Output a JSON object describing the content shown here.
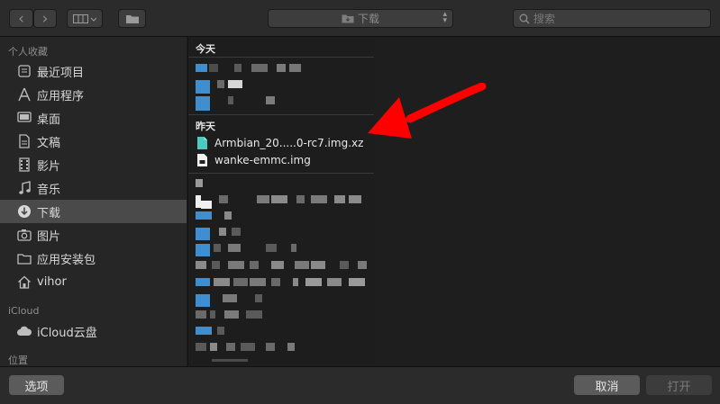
{
  "toolbar": {
    "back_glyph": "‹",
    "forward_glyph": "›",
    "location": "下载",
    "search_placeholder": "搜索"
  },
  "sidebar": {
    "favorites_header": "个人收藏",
    "items": [
      {
        "label": "最近项目",
        "icon": "recent-icon"
      },
      {
        "label": "应用程序",
        "icon": "applications-icon"
      },
      {
        "label": "桌面",
        "icon": "desktop-icon"
      },
      {
        "label": "文稿",
        "icon": "documents-icon"
      },
      {
        "label": "影片",
        "icon": "movies-icon"
      },
      {
        "label": "音乐",
        "icon": "music-icon"
      },
      {
        "label": "下载",
        "icon": "downloads-icon",
        "selected": true
      },
      {
        "label": "图片",
        "icon": "pictures-icon"
      },
      {
        "label": "应用安装包",
        "icon": "folder-icon"
      },
      {
        "label": "vihor",
        "icon": "home-icon"
      }
    ],
    "icloud_header": "iCloud",
    "icloud_items": [
      {
        "label": "iCloud云盘",
        "icon": "cloud-icon"
      }
    ],
    "locations_header": "位置"
  },
  "column": {
    "today_header": "今天",
    "yesterday_header": "昨天",
    "files": [
      {
        "name": "Armbian_20.....0-rc7.img.xz",
        "icon": "archive-file-icon"
      },
      {
        "name": "wanke-emmc.img",
        "icon": "document-file-icon"
      }
    ]
  },
  "footer": {
    "options_label": "选项",
    "cancel_label": "取消",
    "open_label": "打开"
  },
  "colors": {
    "annotation_arrow": "#ff0000",
    "selection": "#4a4a4a",
    "blur_blue": "#3f8fd0"
  }
}
